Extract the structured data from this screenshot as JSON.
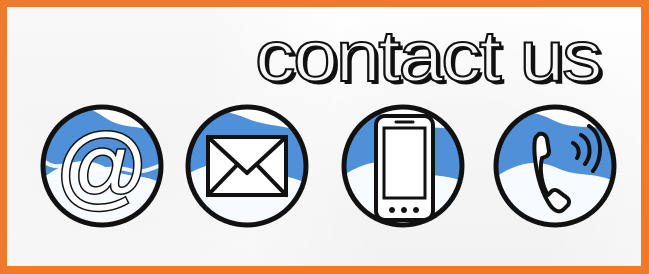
{
  "header": {
    "title": "contact us"
  },
  "icons": [
    {
      "name": "at-sign-icon",
      "label": "@"
    },
    {
      "name": "envelope-icon"
    },
    {
      "name": "smartphone-icon"
    },
    {
      "name": "phone-call-icon"
    }
  ],
  "colors": {
    "border": "#f07a2c",
    "blue": "#4f90d9",
    "ink": "#111111",
    "paper": "#fbfbfb"
  }
}
